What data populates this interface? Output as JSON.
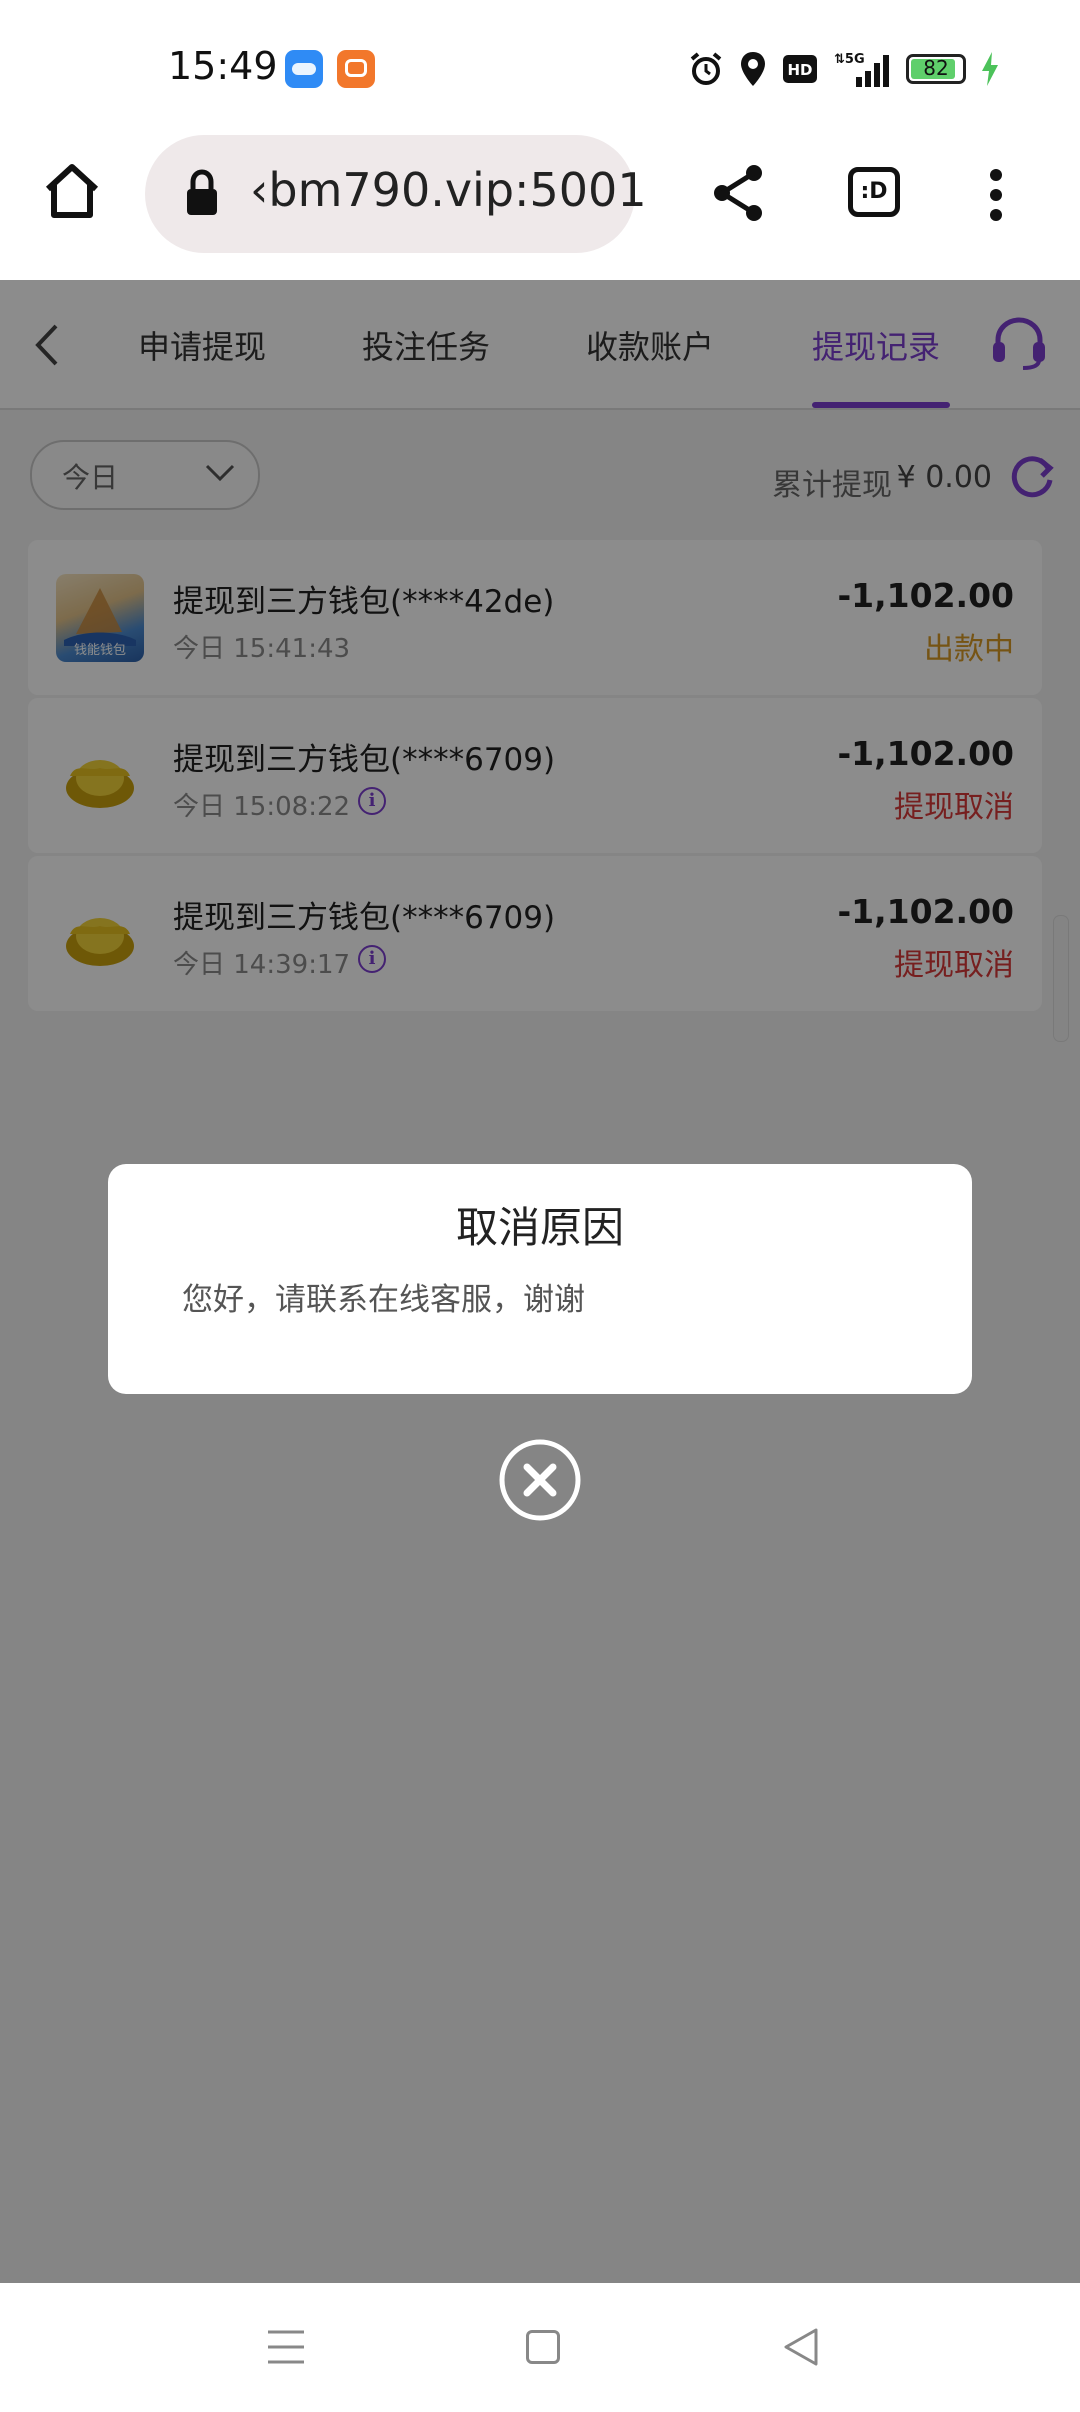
{
  "status_bar": {
    "time": "15:49",
    "app_icons": [
      "hello-app-icon",
      "didi-app-icon"
    ],
    "system_icons": [
      "alarm-icon",
      "location-icon",
      "hd-icon",
      "5g-signal-icon"
    ],
    "battery_level": "82",
    "charging": true
  },
  "browser": {
    "url": "‹bm790.vip:5001",
    "tab_switch_label": ":D"
  },
  "nav_tabs": [
    {
      "label": "申请提现",
      "active": false
    },
    {
      "label": "投注任务",
      "active": false
    },
    {
      "label": "收款账户",
      "active": false
    },
    {
      "label": "提现记录",
      "active": true
    }
  ],
  "filter": {
    "selected": "今日"
  },
  "summary": {
    "label": "累计提现",
    "amount": "¥ 0.00"
  },
  "records": [
    {
      "title": "提现到三方钱包(****42de)",
      "time": "今日 15:41:43",
      "amount": "-1,102.00",
      "status": "出款中",
      "status_color": "#d89a26",
      "logo_text": "钱能钱包",
      "has_info": false
    },
    {
      "title": "提现到三方钱包(****6709)",
      "time": "今日 15:08:22",
      "amount": "-1,102.00",
      "status": "提现取消",
      "status_color": "#d83a3a",
      "has_info": true
    },
    {
      "title": "提现到三方钱包(****6709)",
      "time": "今日 14:39:17",
      "amount": "-1,102.00",
      "status": "提现取消",
      "status_color": "#d83a3a",
      "has_info": true
    }
  ],
  "dialog": {
    "title": "取消原因",
    "message": "您好，请联系在线客服，谢谢"
  },
  "colors": {
    "accent": "#7c3fd0",
    "pending": "#d89a26",
    "cancelled": "#d83a3a"
  }
}
